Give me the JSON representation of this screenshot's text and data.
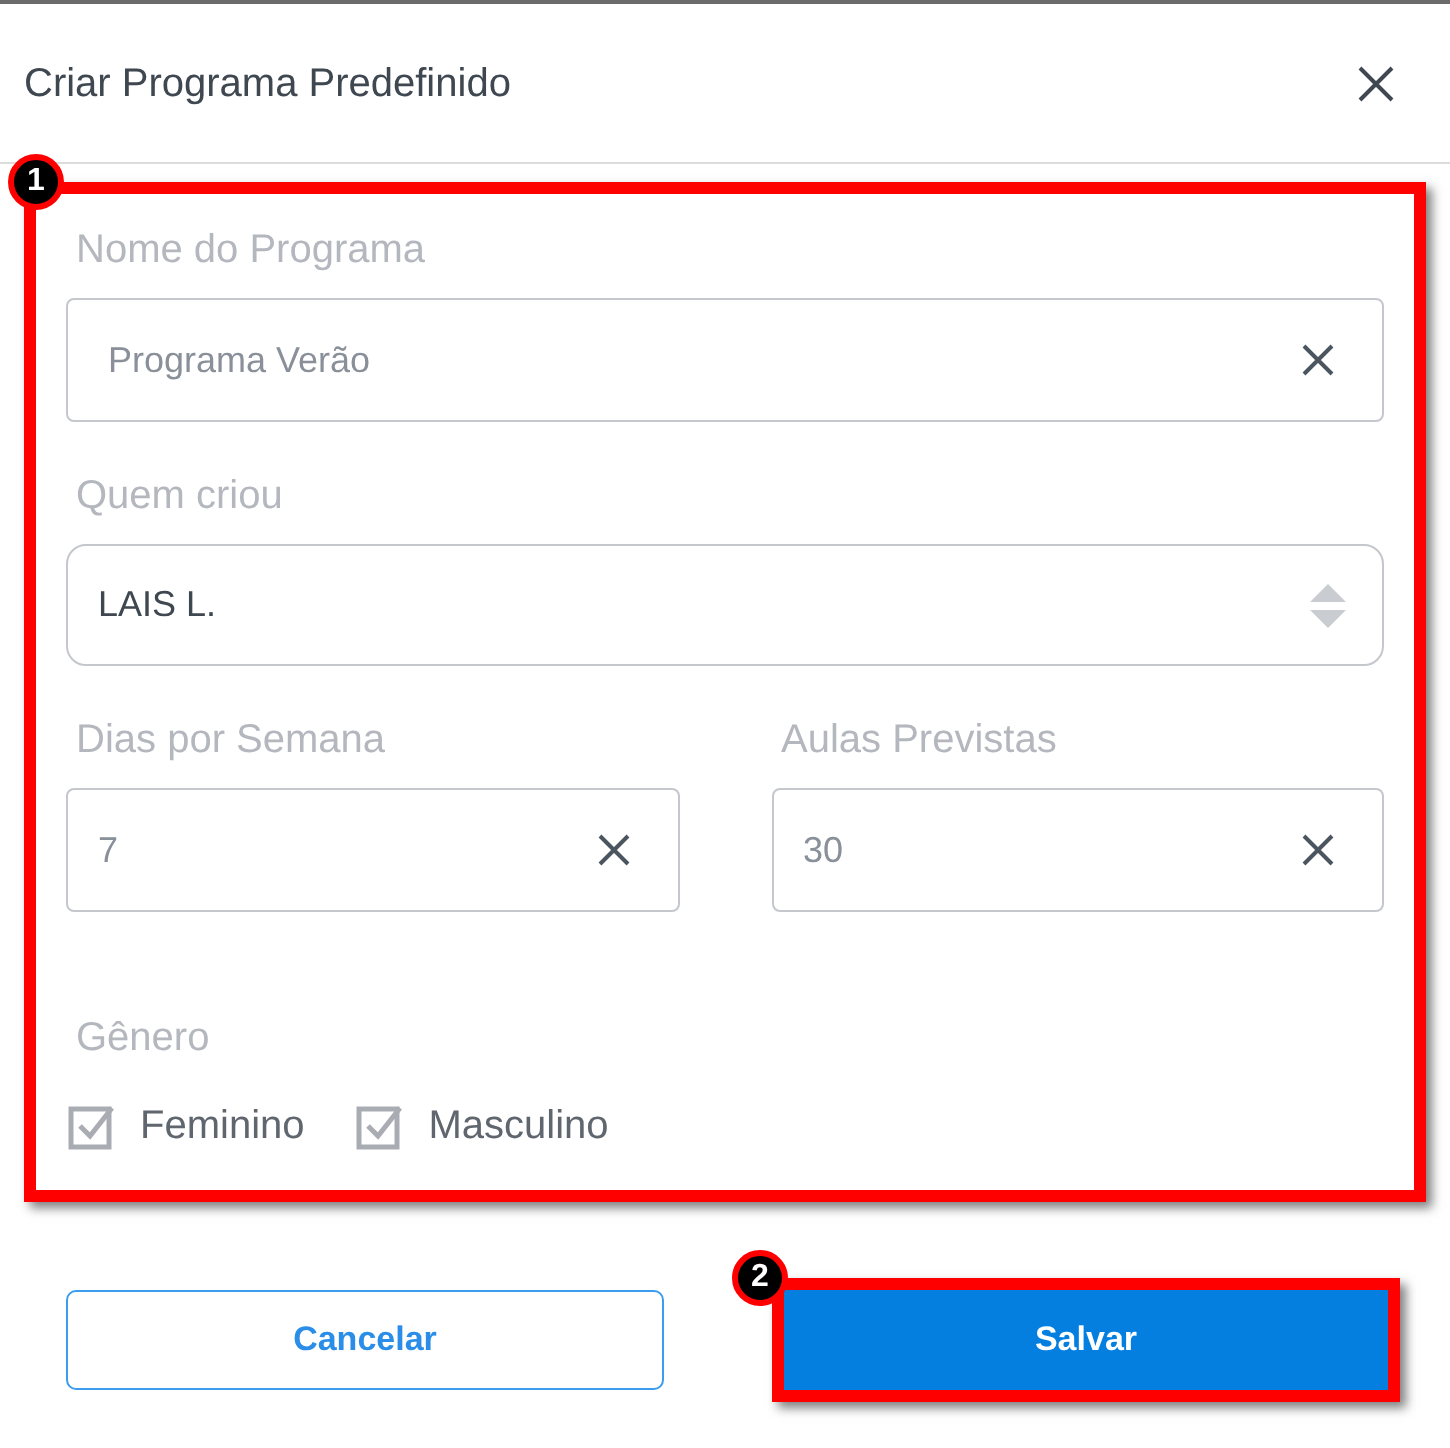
{
  "dialog": {
    "title": "Criar Programa Predefinido"
  },
  "fields": [
    {
      "kind": "text",
      "label": "Nome do Programa",
      "value": "Programa Verão"
    },
    {
      "kind": "select",
      "label": "Quem criou",
      "value": "LAIS L."
    }
  ],
  "row_fields": [
    {
      "kind": "text",
      "label": "Dias por Semana",
      "value": "7"
    },
    {
      "kind": "text",
      "label": "Aulas Previstas",
      "value": "30"
    }
  ],
  "gender": {
    "label": "Gênero",
    "options": [
      {
        "label": "Feminino",
        "checked": true
      },
      {
        "label": "Masculino",
        "checked": true
      }
    ]
  },
  "buttons": [
    {
      "kind": "secondary",
      "label": "Cancelar"
    },
    {
      "kind": "primary",
      "label": "Salvar"
    }
  ],
  "annotations": [
    {
      "number": "1"
    },
    {
      "number": "2"
    }
  ]
}
